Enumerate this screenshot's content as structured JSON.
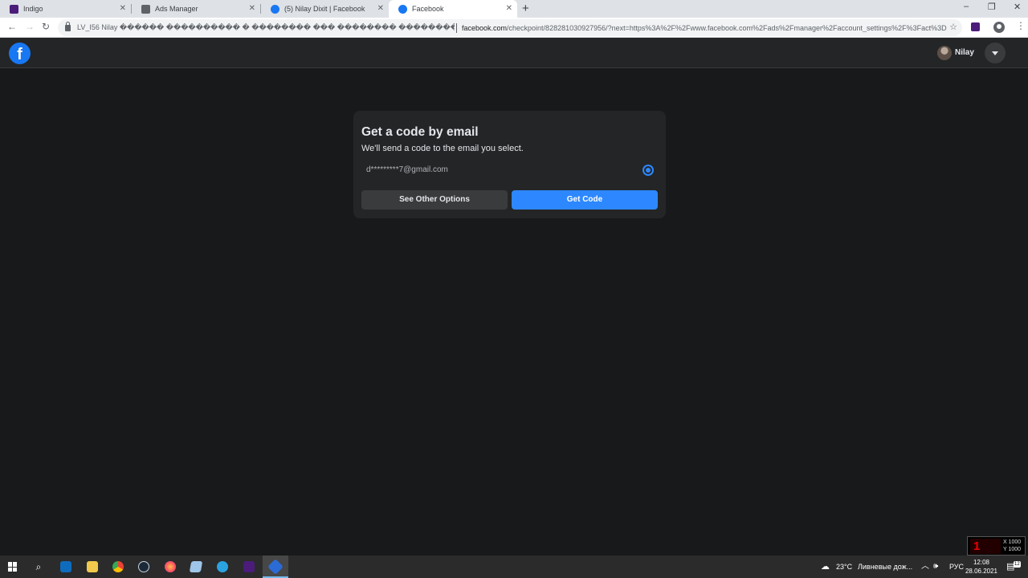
{
  "browser": {
    "tabs": [
      {
        "title": "Indigo",
        "icon": "indigo-icon"
      },
      {
        "title": "Ads Manager",
        "icon": "ads-manager-icon"
      },
      {
        "title": "(5) Nilay Dixit | Facebook",
        "icon": "facebook-icon"
      },
      {
        "title": "Facebook",
        "icon": "facebook-icon",
        "active": true
      }
    ],
    "new_tab": "+",
    "window_controls": {
      "minimize": "–",
      "maximize": "❐",
      "close": "✕"
    },
    "nav": {
      "back": "←",
      "forward": "→",
      "reload": "↻"
    },
    "page_title_text": "LV_I56 Nilay ������ ���������� � �������� ��� �������� ��������",
    "url_host": "facebook.com",
    "url_rest": "/checkpoint/828281030927956/?next=https%3A%2F%2Fwww.facebook.com%2Fads%2Fmanager%2Faccount_settings%2F%3Fact%3D"
  },
  "header": {
    "logo": "f",
    "user_name": "Nilay",
    "menu_icon": "caret-down-icon"
  },
  "card": {
    "title": "Get a code by email",
    "subtitle": "We'll send a code to the email you select.",
    "email": "d*********7@gmail.com",
    "email_selected": true,
    "buttons": {
      "other": "See Other Options",
      "get": "Get Code"
    }
  },
  "overlay": {
    "counter": "1",
    "x_label": "X 1000",
    "y_label": "Y 1000"
  },
  "taskbar": {
    "apps": [
      "start-icon",
      "search-icon",
      "mail-icon",
      "file-explorer-icon",
      "chrome-icon",
      "steam-icon",
      "firefox-icon",
      "notes-icon",
      "telegram-icon",
      "indigo-icon",
      "indigo-browser-icon"
    ],
    "weather_temp": "23°C",
    "weather_text": "Ливневые дож...",
    "language": "РУС",
    "time": "12:08",
    "date": "28.06.2021",
    "notifications": "12"
  },
  "colors": {
    "page_bg": "#18191a",
    "surface": "#242526",
    "primary": "#2d88ff",
    "secondary_button": "#3a3b3c",
    "text_primary": "#e4e6eb",
    "text_secondary": "#b0b3b8"
  }
}
